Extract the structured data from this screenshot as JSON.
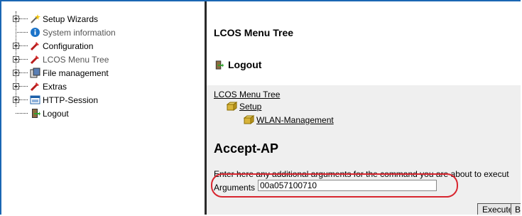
{
  "tree": {
    "items": [
      {
        "label": "Setup Wizards",
        "expandable": true,
        "icon": "wand-icon"
      },
      {
        "label": "System information",
        "expandable": false,
        "icon": "info-icon"
      },
      {
        "label": "Configuration",
        "expandable": true,
        "icon": "tools-icon"
      },
      {
        "label": "LCOS Menu Tree",
        "expandable": true,
        "icon": "tools-icon"
      },
      {
        "label": "File management",
        "expandable": true,
        "icon": "file-icon"
      },
      {
        "label": "Extras",
        "expandable": true,
        "icon": "tools-icon"
      },
      {
        "label": "HTTP-Session",
        "expandable": true,
        "icon": "window-icon"
      },
      {
        "label": "Logout",
        "expandable": false,
        "icon": "logout-icon"
      }
    ]
  },
  "main": {
    "title": "LCOS Menu Tree",
    "logout_label": "Logout",
    "breadcrumb": [
      "LCOS Menu Tree",
      "Setup",
      "WLAN-Management"
    ],
    "section_title": "Accept-AP",
    "description": "Enter here any additional arguments for the command you are about to execut",
    "arguments_label": "Arguments",
    "arguments_value": "00a057100710",
    "execute_label": "Execute",
    "second_button_label": "B"
  },
  "colors": {
    "frame": "#1a66b3",
    "highlight": "#d8262f",
    "panel_bg": "#efefef"
  }
}
